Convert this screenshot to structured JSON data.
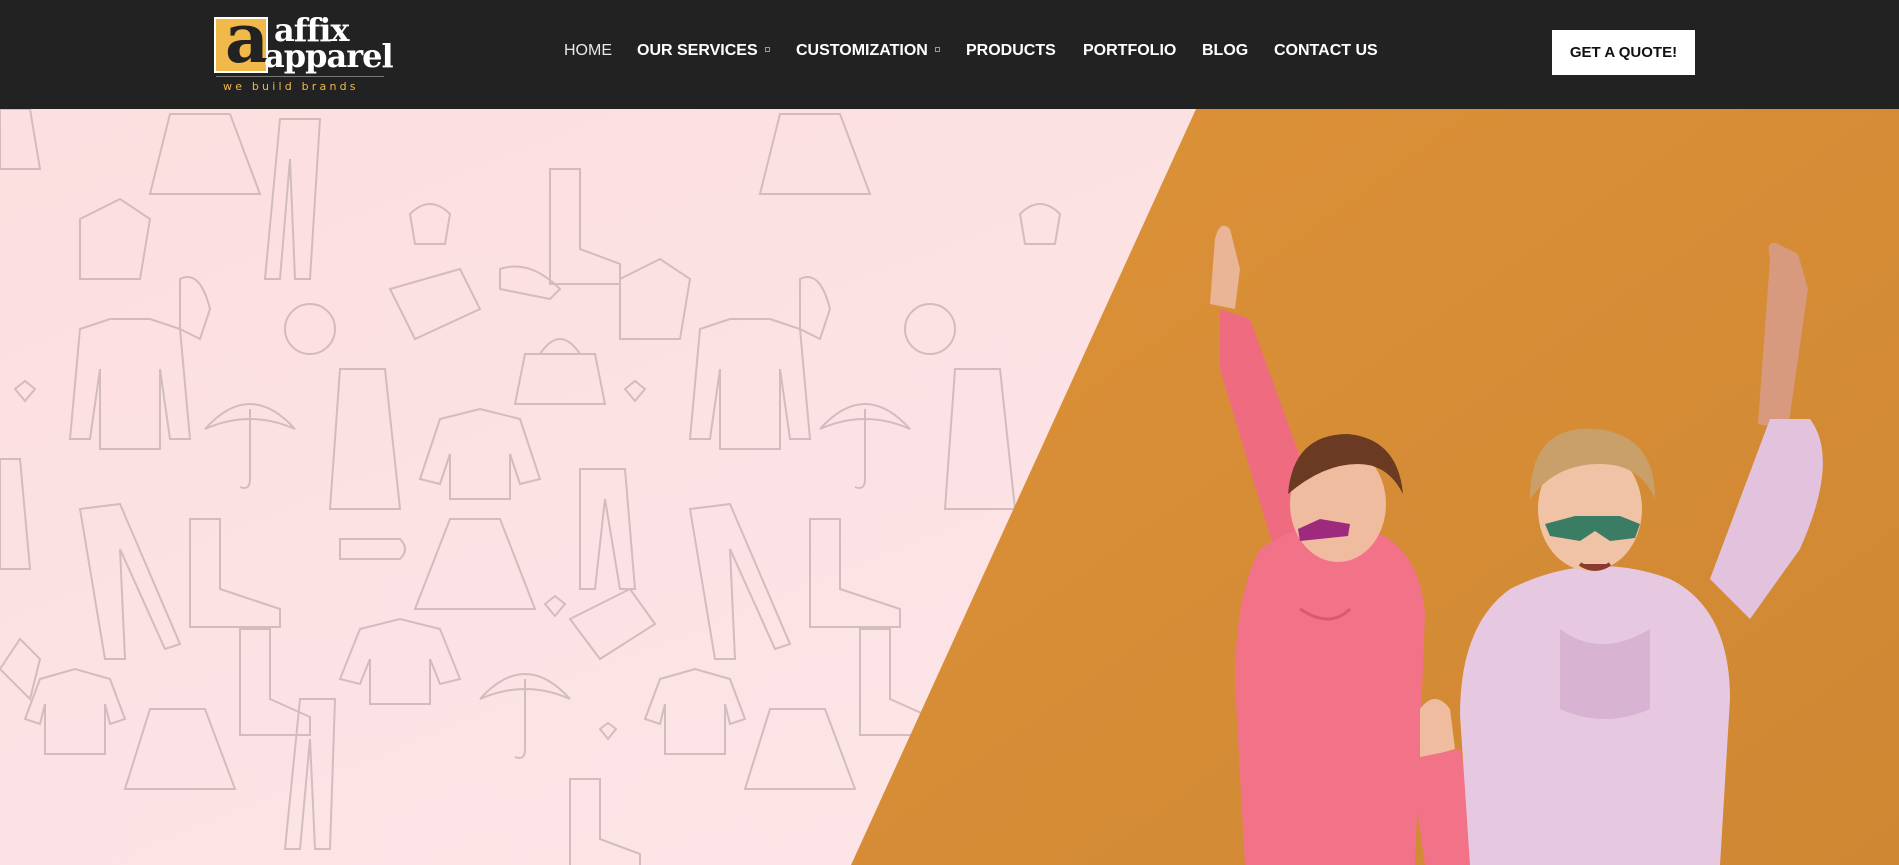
{
  "brand": {
    "logo_letter": "a",
    "name_line1": "affix",
    "name_line2": "apparel",
    "tagline": "we build brands",
    "accent_color": "#f1b84a"
  },
  "nav": {
    "items": [
      {
        "label": "HOME",
        "active": true
      },
      {
        "label": "OUR SERVICES",
        "has_dropdown": true
      },
      {
        "label": "CUSTOMIZATION",
        "has_dropdown": true
      },
      {
        "label": "PRODUCTS"
      },
      {
        "label": "PORTFOLIO"
      },
      {
        "label": "BLOG"
      },
      {
        "label": "CONTACT US"
      }
    ]
  },
  "cta": {
    "label": "GET A QUOTE!"
  },
  "hero": {
    "left_color": "#fde3e4",
    "right_color": "#d98f36",
    "pattern": "clothing-doodle-pattern",
    "photo": "two-women-in-hoodies-and-sunglasses"
  }
}
